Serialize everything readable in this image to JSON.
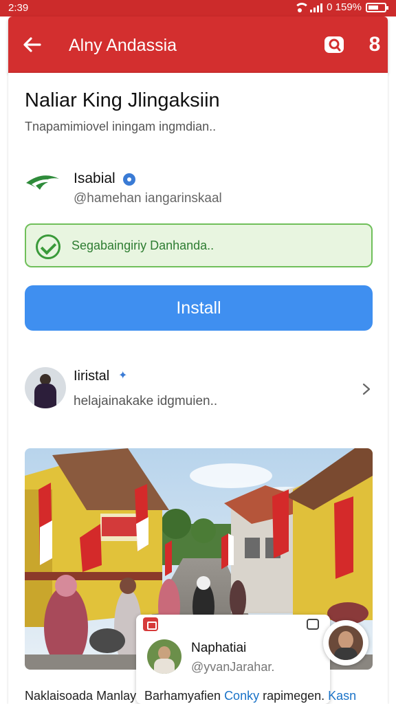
{
  "status_bar": {
    "time": "2:39",
    "battery_text": "0 159%"
  },
  "app_bar": {
    "title": "Alny Andassia",
    "search_icon": "search-icon",
    "more_icon": "more-icon",
    "more_glyph": "8",
    "background": "#d32f2f"
  },
  "header": {
    "title": "Naliar King Jlingaksiin",
    "subtitle": "Tnapamimiovel iningam ingmdian.."
  },
  "publisher": {
    "name": "Isabial",
    "handle": "@hamehan iangarinskaal",
    "verified": true
  },
  "banner": {
    "text": "Segabaingiriy Danhanda..",
    "color": "#2e7d32"
  },
  "install": {
    "label": "Install",
    "color": "#3f8ff0"
  },
  "author": {
    "name": "Iiristal",
    "description": "helajainakake idgmuien.."
  },
  "floating_card": {
    "name": "Naphatiai",
    "handle": "@yvanJarahar."
  },
  "captions": {
    "left": "Naklaisoada Manlay",
    "right_text": "Barhamyafien ",
    "right_link": "Conky",
    "right_text2": " rapimegen. ",
    "right_link2": "Kasn"
  }
}
